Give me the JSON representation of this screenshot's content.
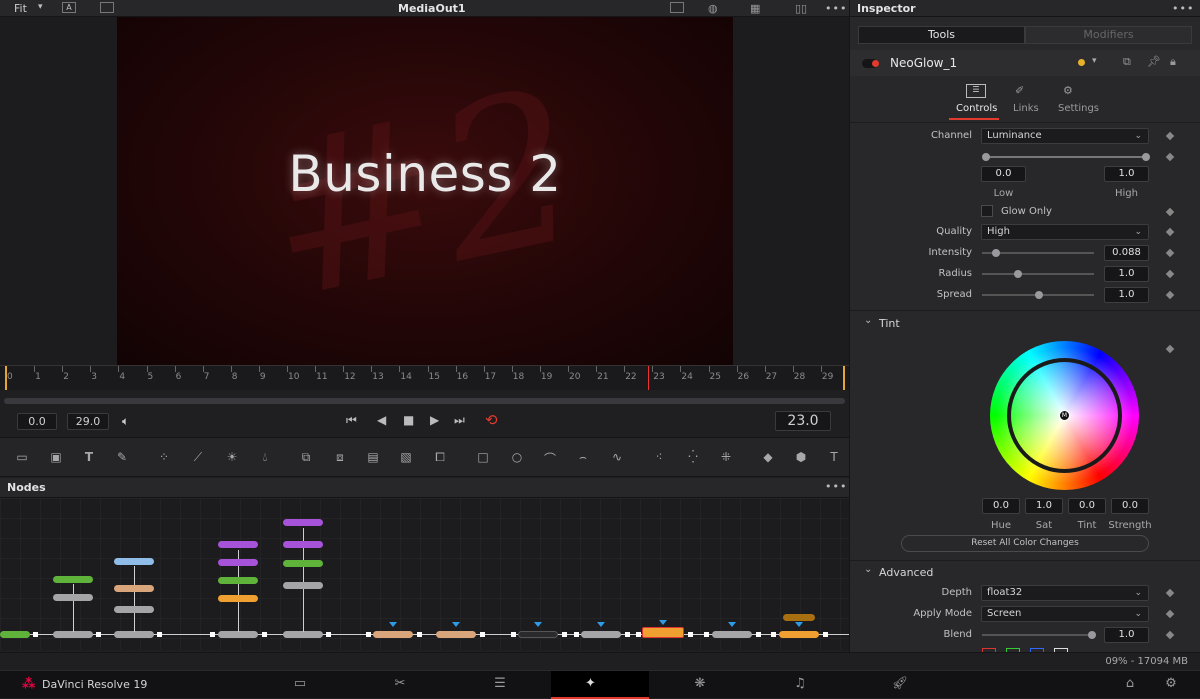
{
  "viewer": {
    "fit_label": "Fit",
    "title": "MediaOut1",
    "frame_text": "Business 2",
    "hash_text": "#2",
    "ruler_ticks": [
      "0",
      "1",
      "2",
      "3",
      "4",
      "5",
      "6",
      "7",
      "8",
      "9",
      "10",
      "11",
      "12",
      "13",
      "14",
      "15",
      "16",
      "17",
      "18",
      "19",
      "20",
      "21",
      "22",
      "23",
      "24",
      "25",
      "26",
      "27",
      "28",
      "29"
    ],
    "start_frame": "0.0",
    "end_frame": "29.0",
    "current_frame": "23.0"
  },
  "nodes_panel": {
    "title": "Nodes"
  },
  "inspector": {
    "title": "Inspector",
    "tabs": [
      "Tools",
      "Modifiers"
    ],
    "node_name": "NeoGlow_1",
    "subtabs": [
      "Controls",
      "Links",
      "Settings"
    ],
    "channel_label": "Channel",
    "channel_value": "Luminance",
    "low_value": "0.0",
    "high_value": "1.0",
    "low_label": "Low",
    "high_label": "High",
    "glow_only_label": "Glow Only",
    "quality_label": "Quality",
    "quality_value": "High",
    "intensity_label": "Intensity",
    "intensity_value": "0.088",
    "radius_label": "Radius",
    "radius_value": "1.0",
    "spread_label": "Spread",
    "spread_value": "1.0",
    "tint_section": "Tint",
    "hue_value": "0.0",
    "sat_value": "1.0",
    "tint_value": "0.0",
    "strength_value": "0.0",
    "hue_label": "Hue",
    "sat_label": "Sat",
    "tint_label": "Tint",
    "strength_label": "Strength",
    "reset_label": "Reset All Color Changes",
    "advanced_section": "Advanced",
    "depth_label": "Depth",
    "depth_value": "float32",
    "apply_mode_label": "Apply Mode",
    "apply_mode_value": "Screen",
    "blend_label": "Blend",
    "blend_value": "1.0",
    "wheel_marker": "M"
  },
  "status": {
    "memory": "09% - 17094 MB"
  },
  "bottom": {
    "app_name": "DaVinci Resolve 19"
  },
  "colors": {
    "accent_red": "#e23b2e",
    "node_orange": "#f0a030",
    "playhead": "#d33"
  }
}
